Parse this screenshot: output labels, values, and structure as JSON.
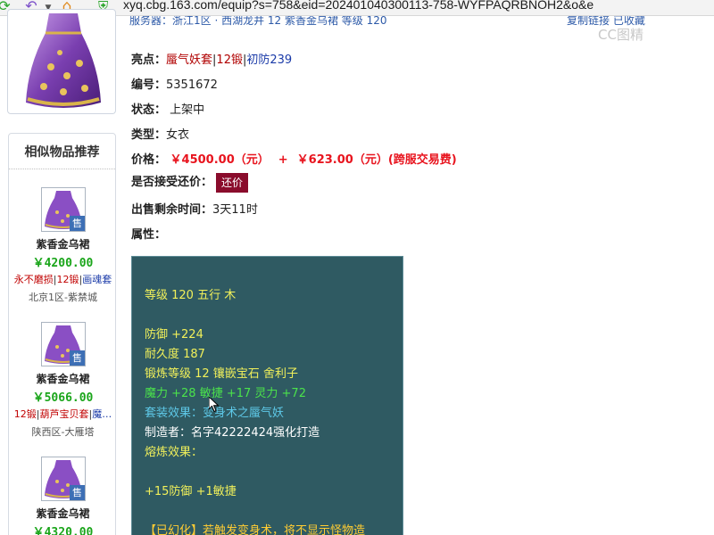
{
  "browser": {
    "url": "xyq.cbg.163.com/equip?s=758&eid=202401040300113-758-WYFPAQRBNOH2&o&e"
  },
  "top_strip": {
    "text": "服务器：浙江1区 · 西湖龙井        12  紫香金乌裙        等级 120",
    "right_text": "复制链接    已收藏",
    "watermark": "CC图精"
  },
  "similar": {
    "title": "相似物品推荐",
    "badge": "售",
    "items": [
      {
        "name": "紫香金乌裙",
        "price": "￥4200.00",
        "tag1": "永不磨损",
        "tag2": "12锻",
        "tag3": "画魂套",
        "server": "北京1区-紫禁城"
      },
      {
        "name": "紫香金乌裙",
        "price": "￥5066.00",
        "tag1": "12锻",
        "tag2": "葫芦宝贝套",
        "tag3": "魔…",
        "server": "陕西区-大雁塔"
      },
      {
        "name": "紫香金乌裙",
        "price": "￥4320.00"
      }
    ]
  },
  "info": {
    "highlight_label": "亮点：",
    "highlight_set": "蜃气妖套",
    "highlight_forge": "12锻",
    "highlight_def": "初防239",
    "id_label": "编号：",
    "id_value": "5351672",
    "status_label": "状态：",
    "status_value": "上架中",
    "type_label": "类型：",
    "type_value": "女衣",
    "price_label": "价格：",
    "price_value": "￥4500.00（元）",
    "price_plus": "+",
    "fee_value": "￥623.00（元）(跨服交易费)",
    "counter_label": "是否接受还价：",
    "counter_button": "还价",
    "remaining_label": "出售剩余时间：",
    "remaining_value": "3天11时",
    "attr_label": "属性："
  },
  "attributes": {
    "level": "等级 120  五行 木",
    "defense": "防御 +224",
    "durability": "耐久度 187",
    "forge": "锻炼等级 12  镶嵌宝石 舍利子",
    "stats": "魔力 +28  敏捷 +17  灵力 +72",
    "set_effect": "套装效果：变身术之蜃气妖",
    "maker": "制造者：名字42222424强化打造",
    "melt_label": "熔炼效果：",
    "melt_value": "+15防御 +1敏捷",
    "illusion": "【已幻化】若触发变身术，将不显示怪物造"
  },
  "colors": {
    "attr_bg": "#2f5a62",
    "price_red": "#e8141e",
    "similar_price_green": "#1aa51a",
    "counter_button_bg": "#8a0c2c"
  }
}
